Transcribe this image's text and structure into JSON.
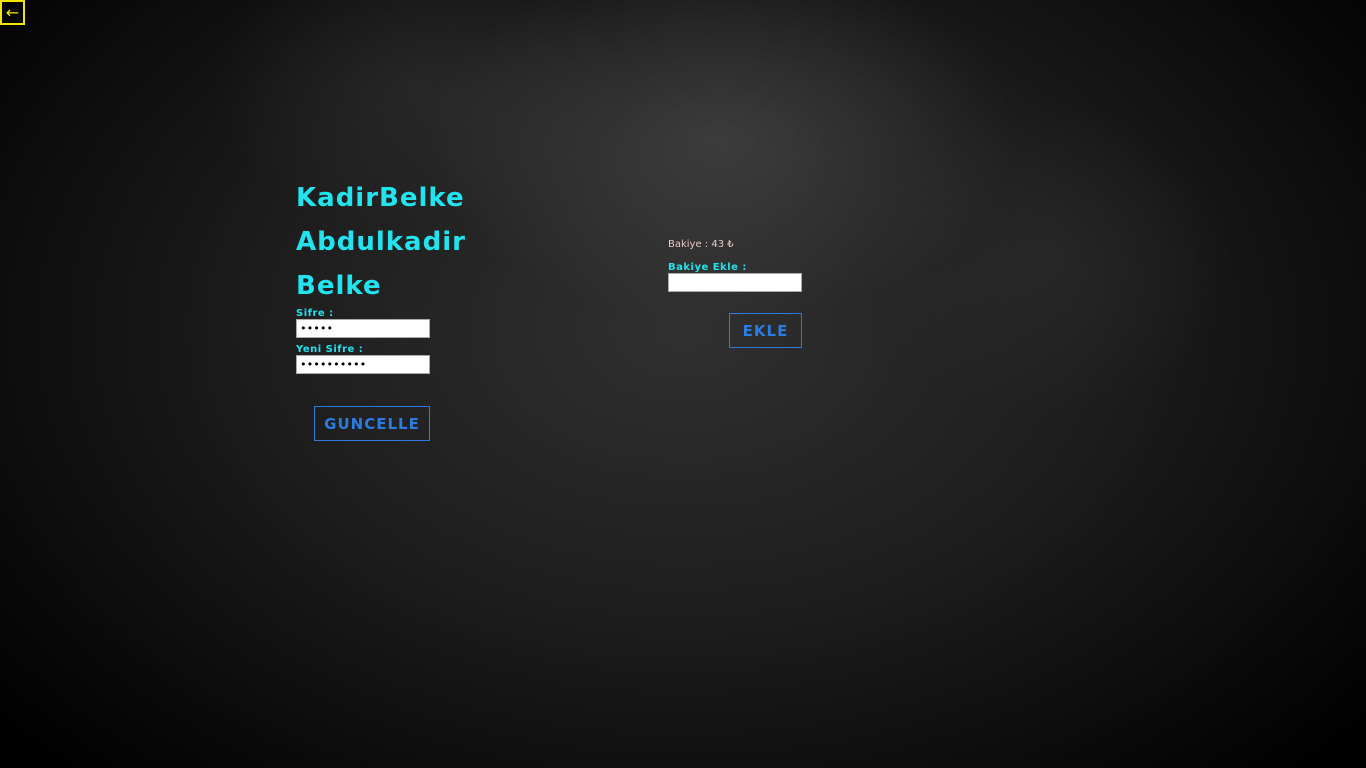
{
  "nav": {
    "back_glyph": "←"
  },
  "profile": {
    "username": "KadirBelke",
    "first_name": "Abdulkadir",
    "last_name": "Belke"
  },
  "password_form": {
    "current_label": "Sifre :",
    "current_value": "•••••",
    "new_label": "Yeni Sifre :",
    "new_value": "••••••••••",
    "submit_label": "GUNCELLE"
  },
  "balance": {
    "balance_text": "Bakiye : 43 ₺",
    "add_label": "Bakiye Ekle :",
    "add_value": "",
    "submit_label": "EKLE"
  },
  "colors": {
    "accent_cyan": "#22e3ee",
    "button_blue": "#2c7be0",
    "back_yellow": "#f2e600",
    "balance_pink": "#e8c7c7"
  }
}
